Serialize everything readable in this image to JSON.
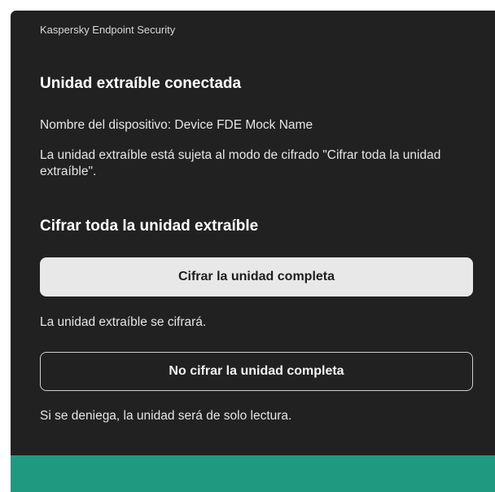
{
  "window": {
    "app_title": "Kaspersky Endpoint Security"
  },
  "main": {
    "heading": "Unidad extraíble conectada",
    "device_line": "Nombre del dispositivo: Device FDE Mock Name",
    "policy_text": "La unidad extraíble está sujeta al modo de cifrado \"Cifrar toda la unidad extraíble\".",
    "section_heading": "Cifrar toda la unidad extraíble"
  },
  "actions": {
    "encrypt_label": "Cifrar la unidad completa",
    "encrypt_result": "La unidad extraíble se cifrará.",
    "decline_label": "No cifrar la unidad completa",
    "decline_result": "Si se deniega, la unidad será de solo lectura."
  },
  "colors": {
    "background": "#212121",
    "footer_accent": "#1f9a80",
    "primary_button": "#e8e8e8"
  }
}
